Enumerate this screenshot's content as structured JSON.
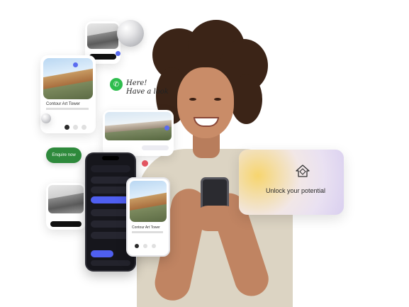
{
  "cards": {
    "top_card": {
      "button_label": ""
    },
    "left_card": {
      "title": "Contour Art Tower"
    },
    "whatsapp": {
      "message_line1": "Here!",
      "message_line2": "Have a look"
    },
    "enquire_button": {
      "label": "Enquire now"
    },
    "bottom_left_card": {
      "caption": ""
    },
    "white_phone": {
      "title": "Contour Art Tower"
    }
  },
  "unlock_card": {
    "text": "Unlock your potential",
    "icon": "home-outline-icon"
  },
  "colors": {
    "accent_blue": "#5a6cf0",
    "whatsapp_green": "#2fbd4e",
    "enquire_green": "#2e8a3c",
    "gradient_yellow": "#f7d56e",
    "gradient_lavender": "#d9cff0"
  }
}
